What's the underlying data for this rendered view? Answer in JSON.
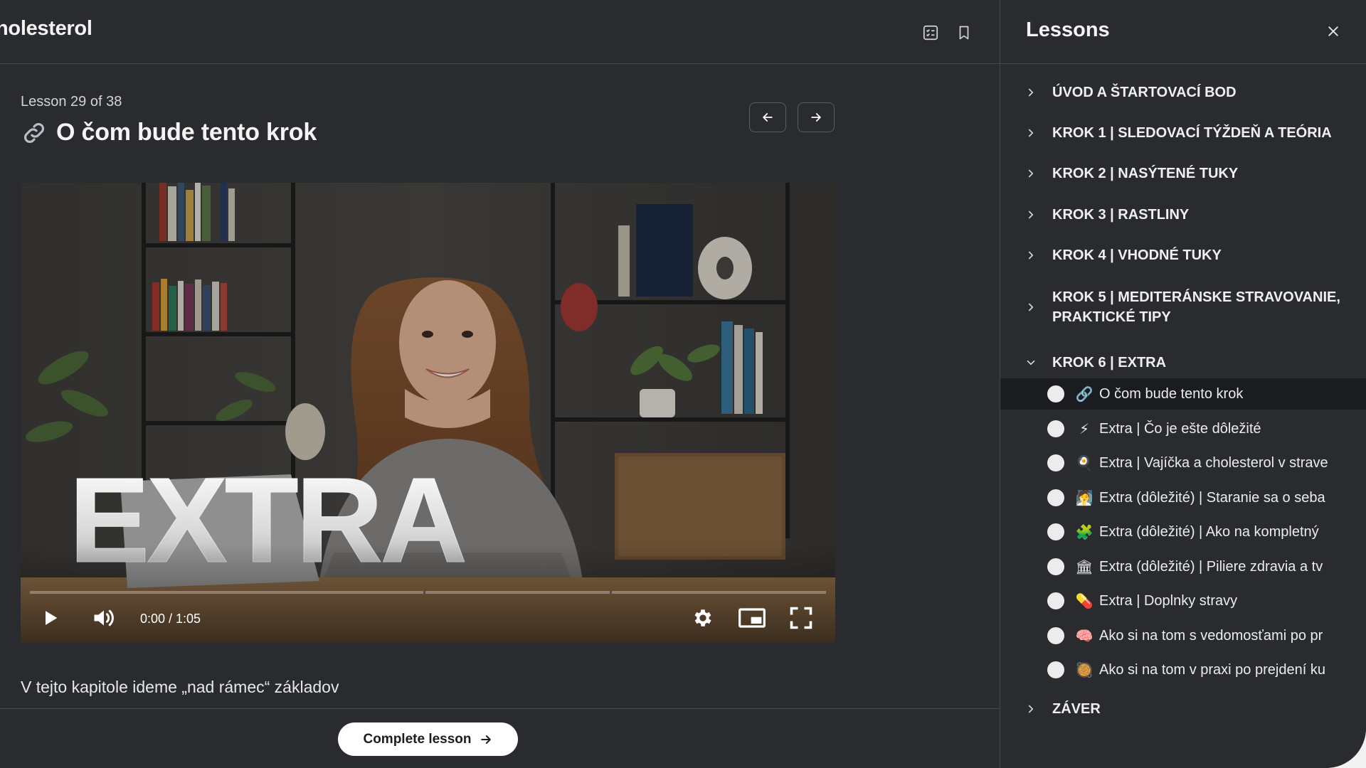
{
  "header": {
    "course_title": "holesterol",
    "notes_icon": "notes-icon",
    "bookmark_icon": "bookmark-icon"
  },
  "lesson": {
    "counter": "Lesson 29 of 38",
    "icon": "link-icon",
    "title": "O čom bude tento krok",
    "description": "V tejto kapitole ideme „nad rámec“ základov"
  },
  "video": {
    "overlay_text": "EXTRA",
    "time": "0:00 / 1:05",
    "progress": 0,
    "controls": [
      "play-icon",
      "volume-icon",
      "settings-icon",
      "miniplayer-icon",
      "fullscreen-icon"
    ]
  },
  "footer": {
    "complete_label": "Complete lesson"
  },
  "sidebar": {
    "title": "Lessons",
    "sections": [
      {
        "label": "ÚVOD A ŠTARTOVACÍ BOD",
        "expanded": false
      },
      {
        "label": "KROK 1 | SLEDOVACÍ TÝŽDEŇ A TEÓRIA",
        "expanded": false
      },
      {
        "label": "KROK 2 | NASÝTENÉ TUKY",
        "expanded": false
      },
      {
        "label": "KROK 3 | RASTLINY",
        "expanded": false
      },
      {
        "label": "KROK 4 | VHODNÉ TUKY",
        "expanded": false
      },
      {
        "label": "KROK 5 | MEDITERÁNSKE STRAVOVANIE, PRAKTICKÉ TIPY",
        "expanded": false
      },
      {
        "label": "KROK 6 | EXTRA",
        "expanded": true
      },
      {
        "label": "ZÁVER",
        "expanded": false
      }
    ],
    "lessons": [
      {
        "emoji": "🔗",
        "icon": "link-icon",
        "label": "O čom bude tento krok",
        "active": true
      },
      {
        "emoji": "⚡",
        "icon": "lightning-icon",
        "label": "Extra | Čo je ešte dôležité",
        "active": false
      },
      {
        "emoji": "🍳",
        "icon": "egg-icon",
        "label": "Extra | Vajíčka a cholesterol v strave",
        "active": false
      },
      {
        "emoji": "🧖",
        "icon": "self-care-icon",
        "label": "Extra (dôležité) | Staranie sa o seba",
        "active": false
      },
      {
        "emoji": "🧩",
        "icon": "puzzle-icon",
        "label": "Extra (dôležité) | Ako na kompletný",
        "active": false
      },
      {
        "emoji": "🏛",
        "icon": "pillars-icon",
        "label": "Extra (dôležité) | Piliere zdravia a tv",
        "active": false
      },
      {
        "emoji": "💊",
        "icon": "pill-icon",
        "label": "Extra | Doplnky stravy",
        "active": false
      },
      {
        "emoji": "🧠",
        "icon": "brain-icon",
        "label": "Ako si na tom s vedomosťami po pr",
        "active": false
      },
      {
        "emoji": "🥘",
        "icon": "food-icon",
        "label": "Ako si na tom v praxi po prejdení ku",
        "active": false
      }
    ]
  }
}
